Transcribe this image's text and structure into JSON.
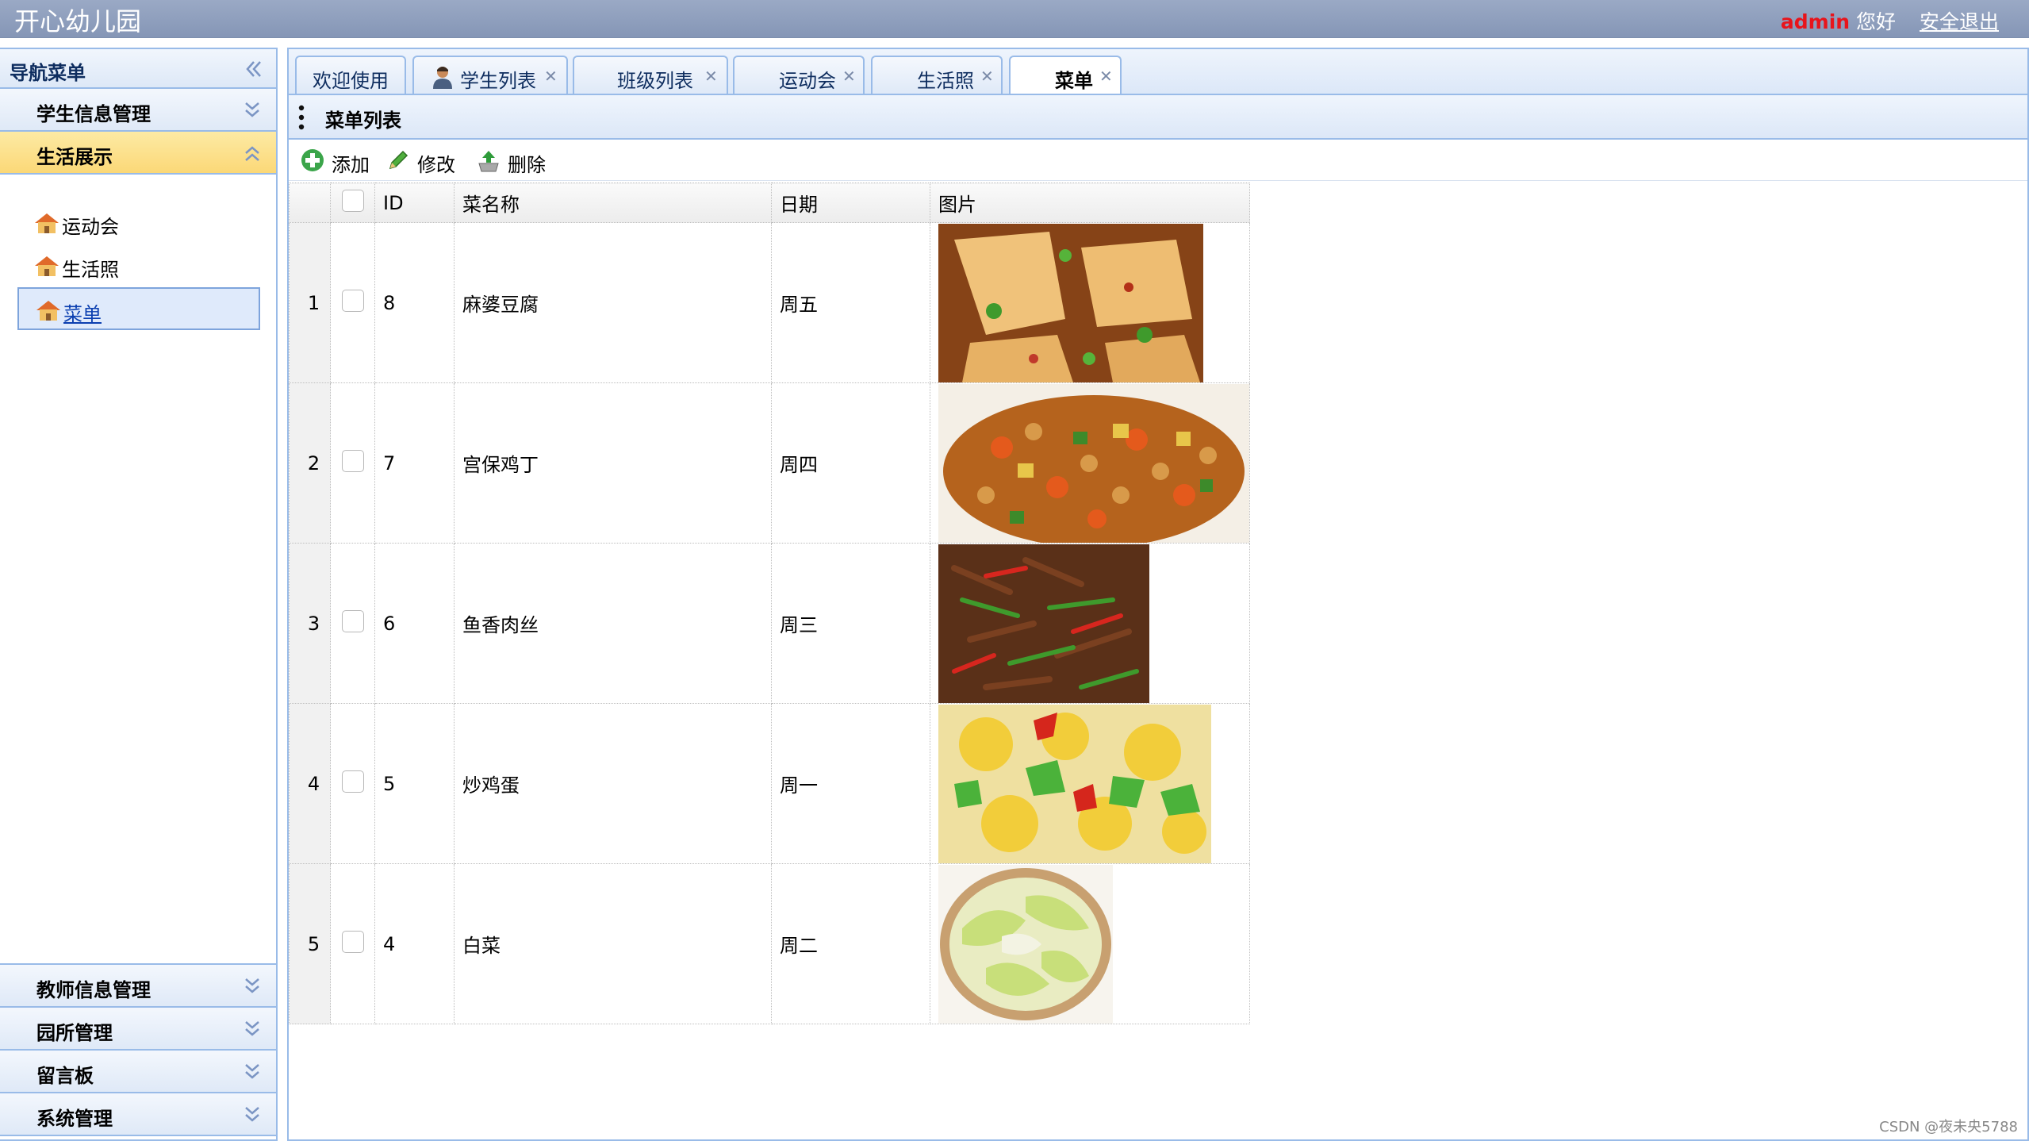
{
  "header": {
    "app_title": "开心幼儿园",
    "user": "admin",
    "greeting": "您好",
    "logout_label": "安全退出"
  },
  "sidebar": {
    "title": "导航菜单",
    "panels": [
      {
        "label": "学生信息管理"
      },
      {
        "label": "生活展示"
      },
      {
        "label": "教师信息管理"
      },
      {
        "label": "园所管理"
      },
      {
        "label": "留言板"
      },
      {
        "label": "系统管理"
      }
    ],
    "subitems": [
      {
        "label": "运动会"
      },
      {
        "label": "生活照"
      },
      {
        "label": "菜单"
      }
    ]
  },
  "tabs": [
    {
      "label": "欢迎使用"
    },
    {
      "label": "学生列表"
    },
    {
      "label": "班级列表"
    },
    {
      "label": "运动会"
    },
    {
      "label": "生活照"
    },
    {
      "label": "菜单"
    }
  ],
  "panel": {
    "title": "菜单列表",
    "toolbar": {
      "add": "添加",
      "edit": "修改",
      "delete": "删除"
    }
  },
  "table": {
    "columns": {
      "id": "ID",
      "name": "菜名称",
      "date": "日期",
      "image": "图片"
    },
    "rows": [
      {
        "num": "1",
        "id": "8",
        "name": "麻婆豆腐",
        "date": "周五",
        "image": "mapo-tofu-photo"
      },
      {
        "num": "2",
        "id": "7",
        "name": "宫保鸡丁",
        "date": "周四",
        "image": "kung-pao-chicken-photo"
      },
      {
        "num": "3",
        "id": "6",
        "name": "鱼香肉丝",
        "date": "周三",
        "image": "yuxiang-pork-photo"
      },
      {
        "num": "4",
        "id": "5",
        "name": "炒鸡蛋",
        "date": "周一",
        "image": "scrambled-egg-photo"
      },
      {
        "num": "5",
        "id": "4",
        "name": "白菜",
        "date": "周二",
        "image": "cabbage-photo"
      }
    ]
  },
  "watermark": "CSDN @夜未央5788",
  "colors": {
    "header_bg": "#8fa0bf",
    "accent_border": "#99bbe8",
    "active_panel": "#fbd877",
    "user_red": "#e8141b"
  }
}
